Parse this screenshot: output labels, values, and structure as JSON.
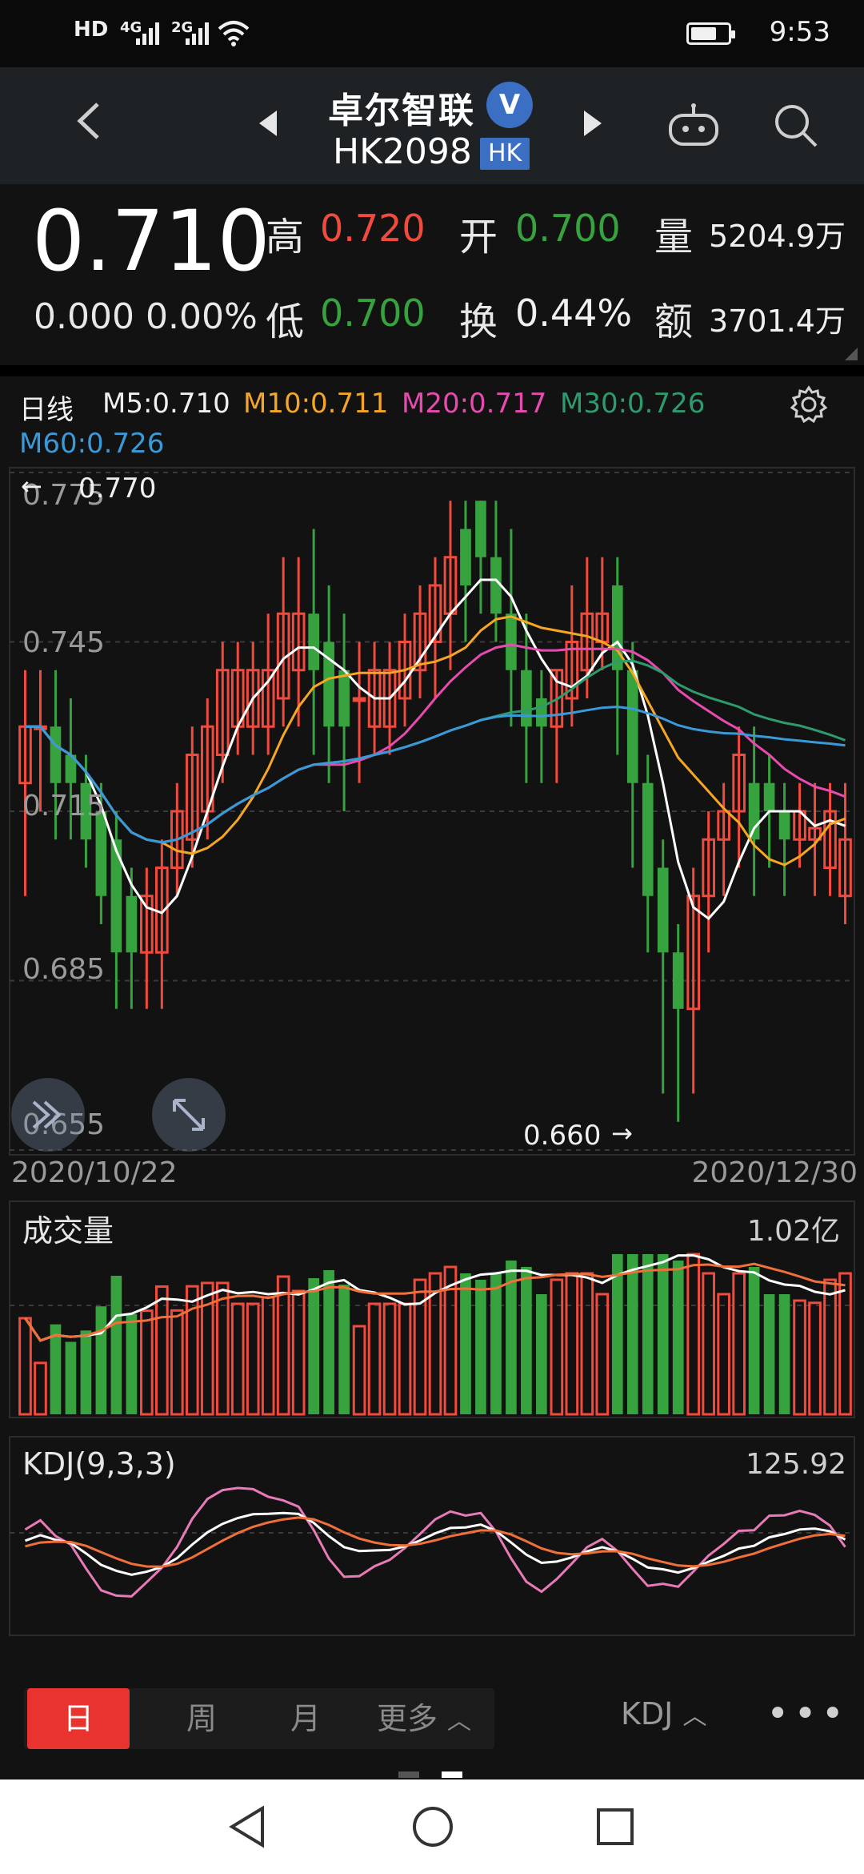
{
  "status_bar": {
    "hd": "HD",
    "sim1": "4G",
    "sim2": "2G",
    "battery_percent": 70,
    "time": "9:53"
  },
  "header": {
    "stock_name": "卓尔智联",
    "verified_badge": "V",
    "stock_code": "HK2098",
    "market_tag": "HK"
  },
  "quote": {
    "price": "0.710",
    "change": "0.000",
    "change_pct": "0.00%",
    "high_label": "高",
    "high": "0.720",
    "low_label": "低",
    "low": "0.700",
    "open_label": "开",
    "open": "0.700",
    "turnover_label": "换",
    "turnover": "0.44%",
    "volume_label": "量",
    "volume": "5204.9万",
    "amount_label": "额",
    "amount": "3701.4万"
  },
  "ma_legend": {
    "period": "日线",
    "m5": "M5:0.710",
    "m10": "M10:0.711",
    "m20": "M20:0.717",
    "m30": "M30:0.726",
    "m60": "M60:0.726"
  },
  "colors": {
    "up": "#f04b3c",
    "down": "#36a33f",
    "m5": "#ffffff",
    "m10": "#f5a623",
    "m20": "#e84bb0",
    "m30": "#2e9b6e",
    "m60": "#3a9ad9"
  },
  "chart_data": {
    "type": "candlestick",
    "y_ticks": [
      "0.775",
      "0.745",
      "0.715",
      "0.685",
      "0.655"
    ],
    "ylim": [
      0.655,
      0.775
    ],
    "high_marker": "0.770",
    "low_marker": "0.660",
    "start_date": "2020/10/22",
    "end_date": "2020/12/30",
    "candles": [
      [
        0.72,
        0.73,
        0.7,
        0.74
      ],
      [
        0.73,
        0.73,
        0.715,
        0.74
      ],
      [
        0.73,
        0.72,
        0.71,
        0.74
      ],
      [
        0.725,
        0.72,
        0.71,
        0.735
      ],
      [
        0.72,
        0.71,
        0.705,
        0.725
      ],
      [
        0.715,
        0.7,
        0.695,
        0.72
      ],
      [
        0.71,
        0.69,
        0.68,
        0.715
      ],
      [
        0.7,
        0.69,
        0.68,
        0.705
      ],
      [
        0.69,
        0.7,
        0.68,
        0.705
      ],
      [
        0.69,
        0.705,
        0.68,
        0.71
      ],
      [
        0.705,
        0.715,
        0.7,
        0.72
      ],
      [
        0.71,
        0.725,
        0.705,
        0.73
      ],
      [
        0.715,
        0.73,
        0.71,
        0.735
      ],
      [
        0.725,
        0.74,
        0.72,
        0.745
      ],
      [
        0.73,
        0.74,
        0.725,
        0.745
      ],
      [
        0.73,
        0.74,
        0.725,
        0.745
      ],
      [
        0.73,
        0.74,
        0.725,
        0.75
      ],
      [
        0.735,
        0.75,
        0.73,
        0.76
      ],
      [
        0.74,
        0.75,
        0.73,
        0.76
      ],
      [
        0.75,
        0.74,
        0.725,
        0.765
      ],
      [
        0.745,
        0.73,
        0.72,
        0.755
      ],
      [
        0.74,
        0.73,
        0.715,
        0.75
      ],
      [
        0.735,
        0.735,
        0.72,
        0.745
      ],
      [
        0.73,
        0.74,
        0.725,
        0.745
      ],
      [
        0.73,
        0.74,
        0.725,
        0.745
      ],
      [
        0.735,
        0.745,
        0.73,
        0.75
      ],
      [
        0.74,
        0.75,
        0.735,
        0.755
      ],
      [
        0.745,
        0.755,
        0.735,
        0.76
      ],
      [
        0.75,
        0.76,
        0.74,
        0.77
      ],
      [
        0.765,
        0.755,
        0.745,
        0.77
      ],
      [
        0.77,
        0.76,
        0.75,
        0.77
      ],
      [
        0.76,
        0.75,
        0.745,
        0.77
      ],
      [
        0.75,
        0.74,
        0.73,
        0.765
      ],
      [
        0.74,
        0.73,
        0.72,
        0.75
      ],
      [
        0.735,
        0.73,
        0.72,
        0.74
      ],
      [
        0.73,
        0.74,
        0.72,
        0.74
      ],
      [
        0.735,
        0.745,
        0.73,
        0.755
      ],
      [
        0.74,
        0.75,
        0.735,
        0.76
      ],
      [
        0.745,
        0.75,
        0.74,
        0.76
      ],
      [
        0.755,
        0.74,
        0.725,
        0.76
      ],
      [
        0.74,
        0.72,
        0.705,
        0.745
      ],
      [
        0.72,
        0.7,
        0.69,
        0.725
      ],
      [
        0.705,
        0.69,
        0.665,
        0.71
      ],
      [
        0.69,
        0.68,
        0.66,
        0.695
      ],
      [
        0.68,
        0.7,
        0.665,
        0.705
      ],
      [
        0.7,
        0.71,
        0.69,
        0.715
      ],
      [
        0.71,
        0.715,
        0.7,
        0.72
      ],
      [
        0.715,
        0.725,
        0.705,
        0.73
      ],
      [
        0.72,
        0.71,
        0.7,
        0.73
      ],
      [
        0.72,
        0.715,
        0.705,
        0.725
      ],
      [
        0.715,
        0.71,
        0.7,
        0.72
      ],
      [
        0.71,
        0.715,
        0.705,
        0.72
      ],
      [
        0.71,
        0.712,
        0.7,
        0.72
      ],
      [
        0.705,
        0.715,
        0.7,
        0.72
      ],
      [
        0.7,
        0.71,
        0.695,
        0.72
      ]
    ],
    "volume_max_label": "1.02亿",
    "kdj_label": "KDJ(9,3,3)",
    "kdj_value": "125.92"
  },
  "tabs": {
    "day": "日",
    "week": "周",
    "month": "月",
    "more": "更多",
    "indicator": "KDJ",
    "dots": "•••"
  }
}
